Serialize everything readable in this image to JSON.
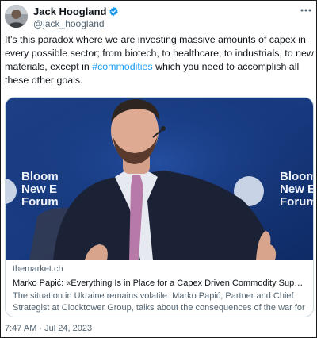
{
  "author": {
    "display_name": "Jack Hoogland",
    "handle": "@jack_hoogland",
    "verified": true,
    "avatar_icon": "profile-photo"
  },
  "more_icon": "more-horizontal-icon",
  "tweet": {
    "text_before": "It’s this paradox where we are investing massive amounts of capex in every possible sector; from biotech, to healthcare, to industrials, to new materials, except in ",
    "hashtag": "#commodities",
    "text_after": " which you need to accomplish all these other goals."
  },
  "link_card": {
    "image_icon": "speaker-photo",
    "backdrop_logo_text": "Bloomberg New Economy Forum",
    "domain": "themarket.ch",
    "title": "Marko Papić: «Everything Is in Place for a Capex Driven Commodity Super-Cy…",
    "description": "The situation in Ukraine remains volatile. Marko Papić, Partner and Chief Strategist at Clocktower Group, talks about the consequences of the war for …"
  },
  "timestamp": "7:47 AM · Jul 24, 2023",
  "colors": {
    "link_blue": "#1d9bf0",
    "text_primary": "#0f1419",
    "text_secondary": "#536471",
    "card_border": "#cfd9de"
  }
}
